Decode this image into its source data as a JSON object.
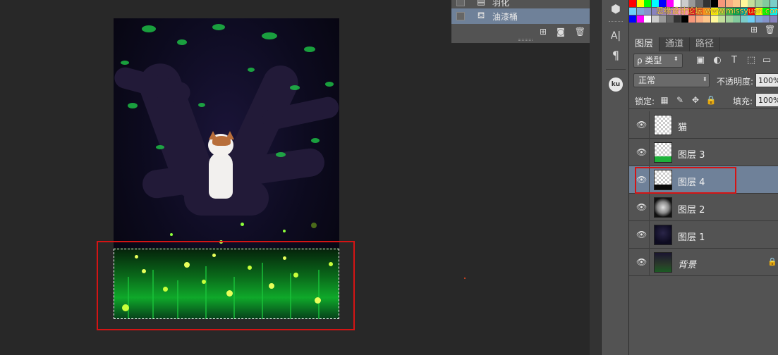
{
  "tool_panel": {
    "rows": [
      {
        "label": "羽化",
        "icon": "document-icon"
      },
      {
        "label": "油漆桶",
        "icon": "paint-bucket-icon"
      }
    ]
  },
  "watermark": "思缘设计论坛 www.missyuan.com",
  "layers_panel": {
    "tabs": [
      "图层",
      "通道",
      "路径"
    ],
    "active_tab": "图层",
    "filter_label": "ρ 类型",
    "blend_mode": "正常",
    "opacity_label": "不透明度:",
    "opacity_value": "100%",
    "lock_label": "锁定:",
    "fill_label": "填充:",
    "fill_value": "100%",
    "layers": [
      {
        "name": "猫",
        "visible": true,
        "selected": false,
        "locked": false
      },
      {
        "name": "图层 3",
        "visible": true,
        "selected": false,
        "locked": false
      },
      {
        "name": "图层 4",
        "visible": true,
        "selected": true,
        "locked": false
      },
      {
        "name": "图层 2",
        "visible": true,
        "selected": false,
        "locked": false
      },
      {
        "name": "图层 1",
        "visible": true,
        "selected": false,
        "locked": false
      },
      {
        "name": "背景",
        "visible": true,
        "selected": false,
        "locked": true
      }
    ]
  },
  "icon_strip": {
    "buttons": [
      "3d-cube-icon",
      "character-icon",
      "paragraph-icon",
      "kuler-icon"
    ],
    "kuler_text": "ku",
    "character_text": "A|",
    "paragraph_text": "¶"
  },
  "colors": {
    "panel_bg": "#535353",
    "canvas_bg": "#282828",
    "selected_row": "#6f8199",
    "highlight_red": "#d41414"
  }
}
